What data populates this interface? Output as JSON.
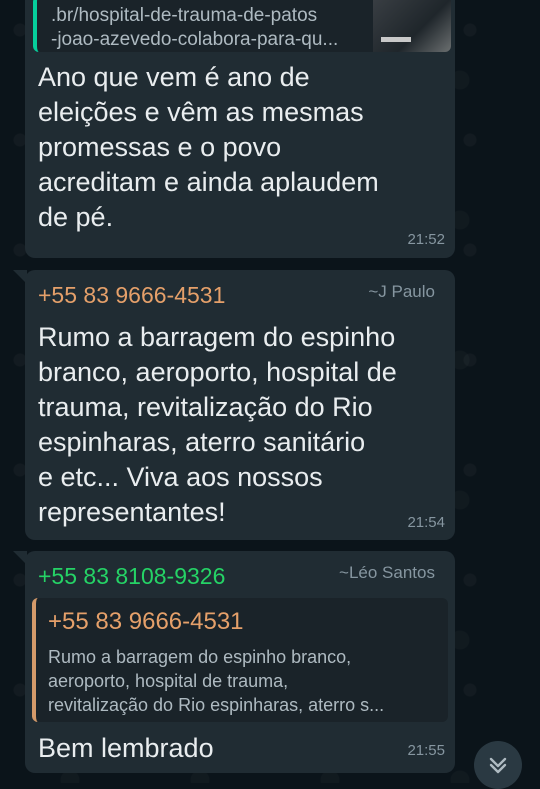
{
  "colors": {
    "wallpaper": "#0b141a",
    "bubble": "#202c33",
    "sender_orange": "#e5a06a",
    "sender_green": "#25d366",
    "timestamp": "#8696a0"
  },
  "messages": [
    {
      "link_url": ".br/hospital-de-trauma-de-patos\n-joao-azevedo-colabora-para-qu...",
      "text": "Ano que vem é ano de\neleições e vêm as mesmas\npromessas e o povo\nacreditam  e ainda aplaudem\nde pé.",
      "time": "21:52"
    },
    {
      "sender": "+55 83 9666-4531",
      "alias": "~J Paulo",
      "text": "Rumo a barragem do espinho\nbranco, aeroporto, hospital de\ntrauma, revitalização do Rio\nespinharas, aterro sanitário\ne etc... Viva aos nossos\nrepresentantes!",
      "time": "21:54"
    },
    {
      "sender": "+55 83 8108-9326",
      "alias": "~Léo Santos",
      "quote_sender": "+55 83 9666-4531",
      "quote_text": "Rumo a barragem do espinho branco,\naeroporto, hospital de trauma,\nrevitalização do Rio espinharas, aterro s...",
      "text": "Bem lembrado",
      "time": "21:55"
    }
  ],
  "scroll_icon": "chevron-double-down-icon"
}
